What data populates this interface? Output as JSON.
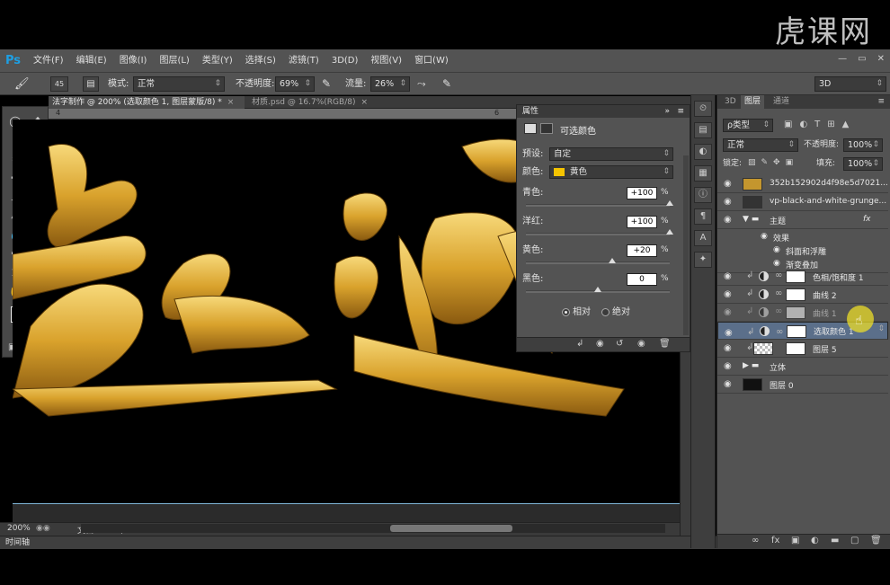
{
  "watermark": "虎课网",
  "menubar": {
    "logo": "Ps",
    "items": [
      "文件(F)",
      "编辑(E)",
      "图像(I)",
      "图层(L)",
      "类型(Y)",
      "选择(S)",
      "滤镜(T)",
      "3D(D)",
      "视图(V)",
      "窗口(W)"
    ],
    "window_buttons": [
      "—",
      "▭",
      "✕"
    ]
  },
  "options": {
    "brush_size": "45",
    "mode_label": "模式:",
    "mode_value": "正常",
    "opacity_label": "不透明度:",
    "opacity_value": "69%",
    "flow_label": "流量:",
    "flow_value": "26%",
    "workspace": "3D"
  },
  "doc_tabs": {
    "active": "法字制作 @ 200% (选取颜色 1, 图层蒙版/8) *",
    "inactive": "材质.psd @ 16.7%(RGB/8)"
  },
  "ruler": [
    "6",
    "4"
  ],
  "status": {
    "zoom": "200%",
    "doc": "文档:1.65M/69.6M"
  },
  "timeline_label": "时间轴",
  "properties": {
    "header": "属性",
    "title": "可选颜色",
    "preset_label": "预设:",
    "preset_value": "自定",
    "color_label": "颜色:",
    "color_value": "黄色",
    "color_swatch": "#f5c400",
    "sliders": [
      {
        "label": "青色:",
        "value": "+100",
        "unit": "%",
        "fraction": 1.0
      },
      {
        "label": "洋红:",
        "value": "+100",
        "unit": "%",
        "fraction": 1.0
      },
      {
        "label": "黄色:",
        "value": "+20",
        "unit": "%",
        "fraction": 0.6
      },
      {
        "label": "黑色:",
        "value": "0",
        "unit": "%",
        "fraction": 0.5
      }
    ],
    "mode_relative": "相对",
    "mode_absolute": "绝对"
  },
  "layers_panel": {
    "tabs": [
      "3D",
      "图层",
      "通道"
    ],
    "filter_value": "ρ类型",
    "blend_value": "正常",
    "opacity_label": "不透明度:",
    "opacity_value": "100%",
    "lock_label": "锁定:",
    "fill_label": "填充:",
    "fill_value": "100%",
    "layers": [
      {
        "name": "352b152902d4f98e5d7021..."
      },
      {
        "name": "vp-black-and-white-grunge..."
      },
      {
        "name": "主题",
        "fx": "fx"
      },
      {
        "name": "效果"
      },
      {
        "name": "斜面和浮雕"
      },
      {
        "name": "渐变叠加"
      },
      {
        "name": "色相/饱和度 1"
      },
      {
        "name": "曲线 2"
      },
      {
        "name": "曲线 1"
      },
      {
        "name": "选取颜色 1"
      },
      {
        "name": "图层 5"
      },
      {
        "name": "立体"
      },
      {
        "name": "图层 0"
      }
    ]
  }
}
